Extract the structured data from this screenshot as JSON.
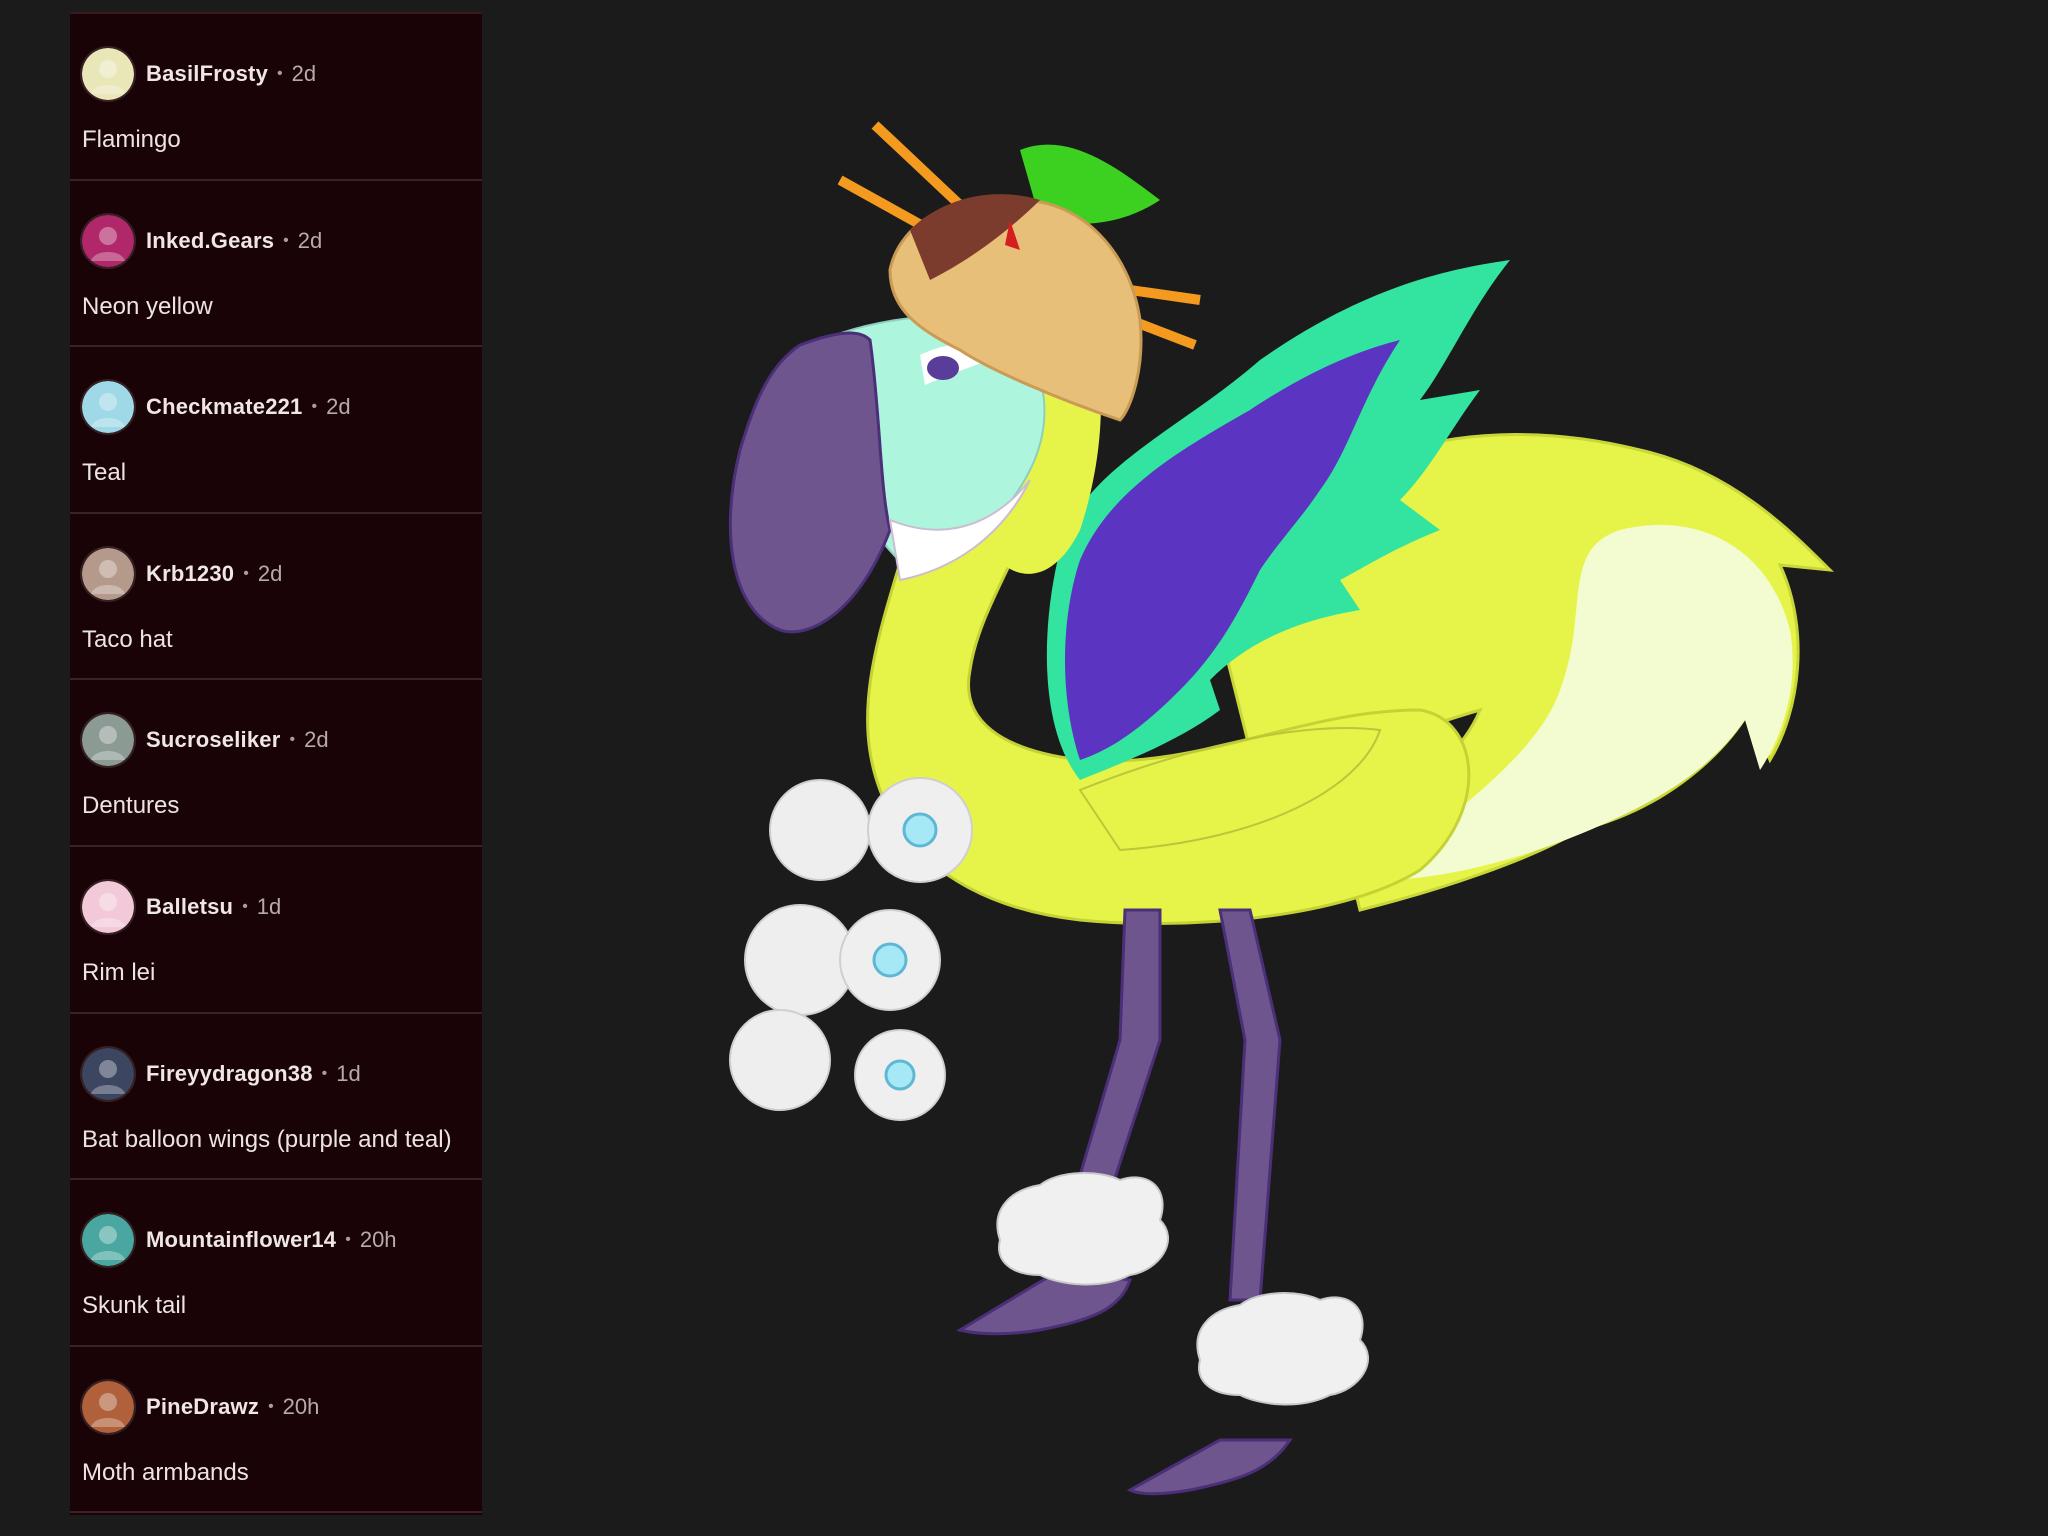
{
  "comments": [
    {
      "username": "BasilFrosty",
      "time": "2d",
      "text": "Flamingo",
      "avatar_color": "#e9e6b8"
    },
    {
      "username": "Inked.Gears",
      "time": "2d",
      "text": "Neon yellow",
      "avatar_color": "#b0286a"
    },
    {
      "username": "Checkmate221",
      "time": "2d",
      "text": "Teal",
      "avatar_color": "#9fd8e6"
    },
    {
      "username": "Krb1230",
      "time": "2d",
      "text": "Taco hat",
      "avatar_color": "#b59a8c"
    },
    {
      "username": "Sucroseliker",
      "time": "2d",
      "text": "Dentures",
      "avatar_color": "#8c9a94"
    },
    {
      "username": "Balletsu",
      "time": "1d",
      "text": "Rim lei",
      "avatar_color": "#f2c9d8"
    },
    {
      "username": "Fireyydragon38",
      "time": "1d",
      "text": "Bat balloon wings (purple and teal)",
      "avatar_color": "#3c4660"
    },
    {
      "username": "Mountainflower14",
      "time": "20h",
      "text": "Skunk tail",
      "avatar_color": "#4aa6a0"
    },
    {
      "username": "PineDrawz",
      "time": "20h",
      "text": "Moth armbands",
      "avatar_color": "#b0603a"
    }
  ],
  "colors": {
    "panel_bg": "#1a0306",
    "page_bg": "#1b1b1b",
    "body_yellow": "#e6f44a",
    "beak_purple": "#6e558e",
    "face_teal": "#aef5de",
    "wing_purple": "#5b34c2",
    "wing_teal": "#33e3a0"
  },
  "icons": [
    "user-avatar-icon"
  ]
}
